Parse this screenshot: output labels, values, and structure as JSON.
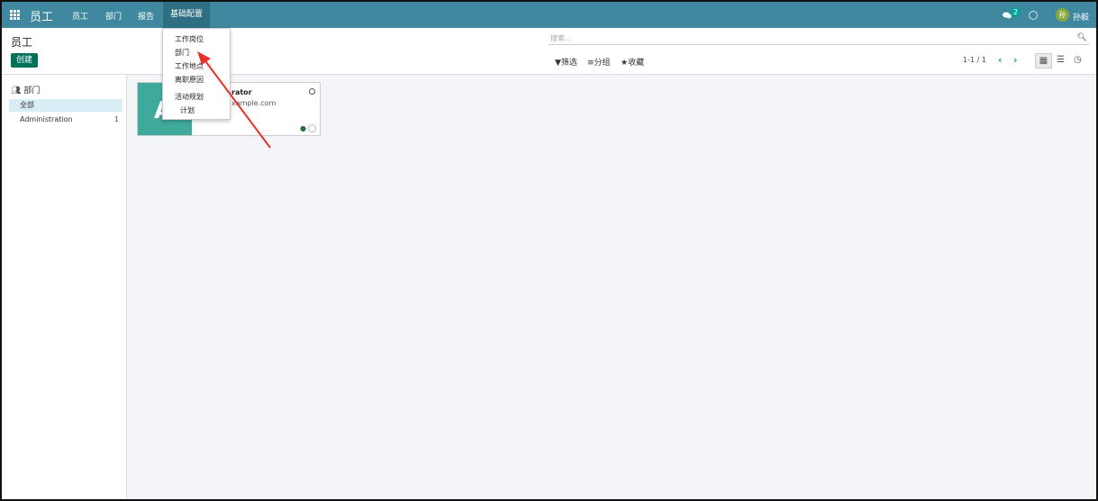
{
  "navbar": {
    "brand": "员工",
    "menu": [
      "员工",
      "部门",
      "报告",
      "基础配置"
    ],
    "notification_count": "2",
    "avatar_initial": "孙",
    "username": "孙毅"
  },
  "control": {
    "breadcrumb": "员工",
    "create_label": "创建",
    "search_placeholder": "搜索...",
    "filter_label": "筛选",
    "group_label": "分组",
    "favorites_label": "收藏",
    "pager": "1-1 / 1"
  },
  "dropdown": {
    "items": [
      "工作岗位",
      "部门",
      "工作地点",
      "离职原因",
      "活动规划",
      "计划"
    ]
  },
  "sidebar": {
    "header": "部门",
    "items": [
      {
        "label": "全部",
        "count": ""
      },
      {
        "label": "Administration",
        "count": "1"
      }
    ]
  },
  "card": {
    "initial": "A",
    "name": "rator",
    "email": "xample.com"
  },
  "colors": {
    "navbar": "#3f889f",
    "primary": "#00715b",
    "accent": "#00a09d",
    "arrow": "#e8302a"
  }
}
